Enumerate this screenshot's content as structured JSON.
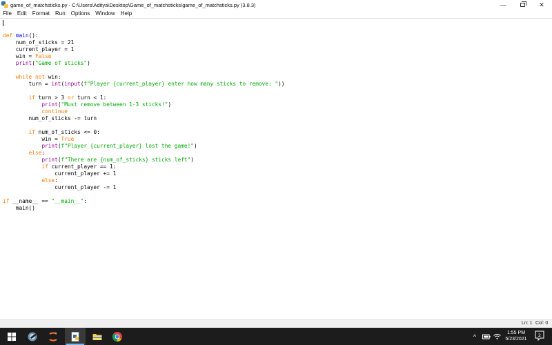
{
  "window": {
    "title": "game_of_matchsticks.py - C:\\Users\\Aditya\\Desktop\\Game_of_matchsticks\\game_of_matchsticks.py (3.8.3)",
    "minimize_glyph": "—",
    "close_glyph": "✕"
  },
  "menu": {
    "items": [
      {
        "label": "File"
      },
      {
        "label": "Edit"
      },
      {
        "label": "Format"
      },
      {
        "label": "Run"
      },
      {
        "label": "Options"
      },
      {
        "label": "Window"
      },
      {
        "label": "Help"
      }
    ]
  },
  "code": {
    "lines": [
      [
        [
          "kw",
          "def "
        ],
        [
          "fn",
          "main"
        ],
        [
          "n",
          "():"
        ]
      ],
      [
        [
          "n",
          "    num_of_sticks = 21"
        ]
      ],
      [
        [
          "n",
          "    current_player = 1"
        ]
      ],
      [
        [
          "n",
          "    win = "
        ],
        [
          "kw",
          "False"
        ]
      ],
      [
        [
          "n",
          "    "
        ],
        [
          "bi",
          "print"
        ],
        [
          "n",
          "("
        ],
        [
          "st",
          "\"Game of sticks\""
        ],
        [
          "n",
          ")"
        ]
      ],
      [],
      [
        [
          "n",
          "    "
        ],
        [
          "kw",
          "while not "
        ],
        [
          "n",
          "win:"
        ]
      ],
      [
        [
          "n",
          "        turn = "
        ],
        [
          "bi",
          "int"
        ],
        [
          "n",
          "("
        ],
        [
          "bi",
          "input"
        ],
        [
          "n",
          "("
        ],
        [
          "st",
          "f\"Player {current_player} enter how many sticks to remove: \""
        ],
        [
          "n",
          "))"
        ]
      ],
      [],
      [
        [
          "n",
          "        "
        ],
        [
          "kw",
          "if "
        ],
        [
          "n",
          "turn > 3 "
        ],
        [
          "kw",
          "or "
        ],
        [
          "n",
          "turn < 1:"
        ]
      ],
      [
        [
          "n",
          "            "
        ],
        [
          "bi",
          "print"
        ],
        [
          "n",
          "("
        ],
        [
          "st",
          "\"Must remove between 1-3 sticks!\""
        ],
        [
          "n",
          ")"
        ]
      ],
      [
        [
          "n",
          "            "
        ],
        [
          "kw",
          "continue"
        ]
      ],
      [
        [
          "n",
          "        num_of_sticks -= turn"
        ]
      ],
      [],
      [
        [
          "n",
          "        "
        ],
        [
          "kw",
          "if "
        ],
        [
          "n",
          "num_of_sticks <= 0:"
        ]
      ],
      [
        [
          "n",
          "            win = "
        ],
        [
          "kw",
          "True"
        ]
      ],
      [
        [
          "n",
          "            "
        ],
        [
          "bi",
          "print"
        ],
        [
          "n",
          "("
        ],
        [
          "st",
          "f\"Player {current_player} lost the game!\""
        ],
        [
          "n",
          ")"
        ]
      ],
      [
        [
          "n",
          "        "
        ],
        [
          "kw",
          "else"
        ],
        [
          "n",
          ":"
        ]
      ],
      [
        [
          "n",
          "            "
        ],
        [
          "bi",
          "print"
        ],
        [
          "n",
          "("
        ],
        [
          "st",
          "f\"There are {num_of_sticks} sticks left\""
        ],
        [
          "n",
          ")"
        ]
      ],
      [
        [
          "n",
          "            "
        ],
        [
          "kw",
          "if "
        ],
        [
          "n",
          "current_player == 1:"
        ]
      ],
      [
        [
          "n",
          "                current_player += 1"
        ]
      ],
      [
        [
          "n",
          "            "
        ],
        [
          "kw",
          "else"
        ],
        [
          "n",
          ":"
        ]
      ],
      [
        [
          "n",
          "                current_player -= 1"
        ]
      ],
      [],
      [
        [
          "kw",
          "if "
        ],
        [
          "n",
          "__name__ == "
        ],
        [
          "st",
          "\"__main__\""
        ],
        [
          "n",
          ":"
        ]
      ],
      [
        [
          "n",
          "    main()"
        ]
      ]
    ]
  },
  "status": {
    "ln": "Ln: 1",
    "col": "Col: 0"
  },
  "taskbar": {
    "time": "1:55 PM",
    "date": "5/23/2021",
    "notification_count": "2",
    "tray_up_glyph": "^"
  },
  "colors": {
    "keyword": "#ff7700",
    "function_name": "#0000ff",
    "builtin": "#900090",
    "string": "#00aa00",
    "taskbar_bg": "#1c1c1c"
  },
  "icons": [
    "python-file-icon",
    "windows-start-icon",
    "app-icon",
    "idle-icon",
    "file-explorer-icon",
    "chrome-icon",
    "battery-icon",
    "wifi-icon",
    "volume-icon",
    "notification-icon"
  ]
}
